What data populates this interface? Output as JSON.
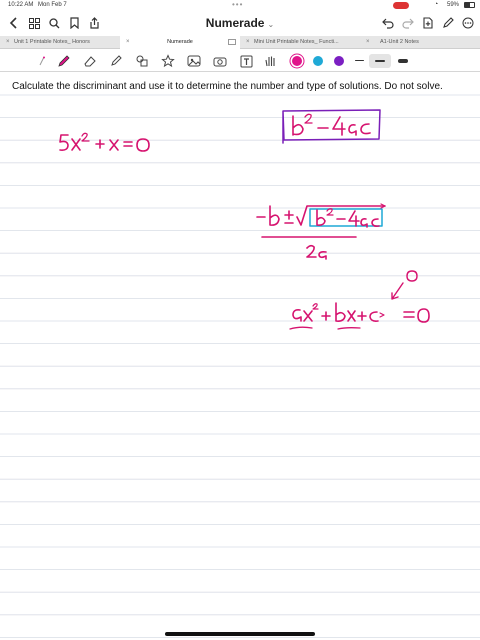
{
  "status": {
    "time": "10:22 AM",
    "date": "Mon Feb 7",
    "battery": "59%"
  },
  "app": {
    "title": "Numerade"
  },
  "tabs": [
    {
      "label": "Unit 1 Printable Notes_ Honors"
    },
    {
      "label": "Numerade"
    },
    {
      "label": "Mini Unit  Printable Notes_ Functi..."
    },
    {
      "label": "A1-Unit 2 Notes"
    }
  ],
  "toolbar": {
    "colors": [
      "#e0148a",
      "#1fa9d6",
      "#7b1fc2"
    ],
    "selected_color": "#e0148a"
  },
  "page": {
    "instruction": "Calculate the discriminant and use it to determine the number and type of solutions. Do not solve.",
    "handwriting": {
      "equation": "5x² + x = 0",
      "discriminant_boxed": "b² − 4ac",
      "quadratic_formula_numerator": "−b ± √(b² − 4ac)",
      "quadratic_formula_denominator": "2a",
      "standard_form": "ax² + bx + c = 0",
      "annotation": "0"
    },
    "ink_color": "#d6136f",
    "box_color": "#7a1fb8",
    "box2_color": "#1fa9d6"
  }
}
